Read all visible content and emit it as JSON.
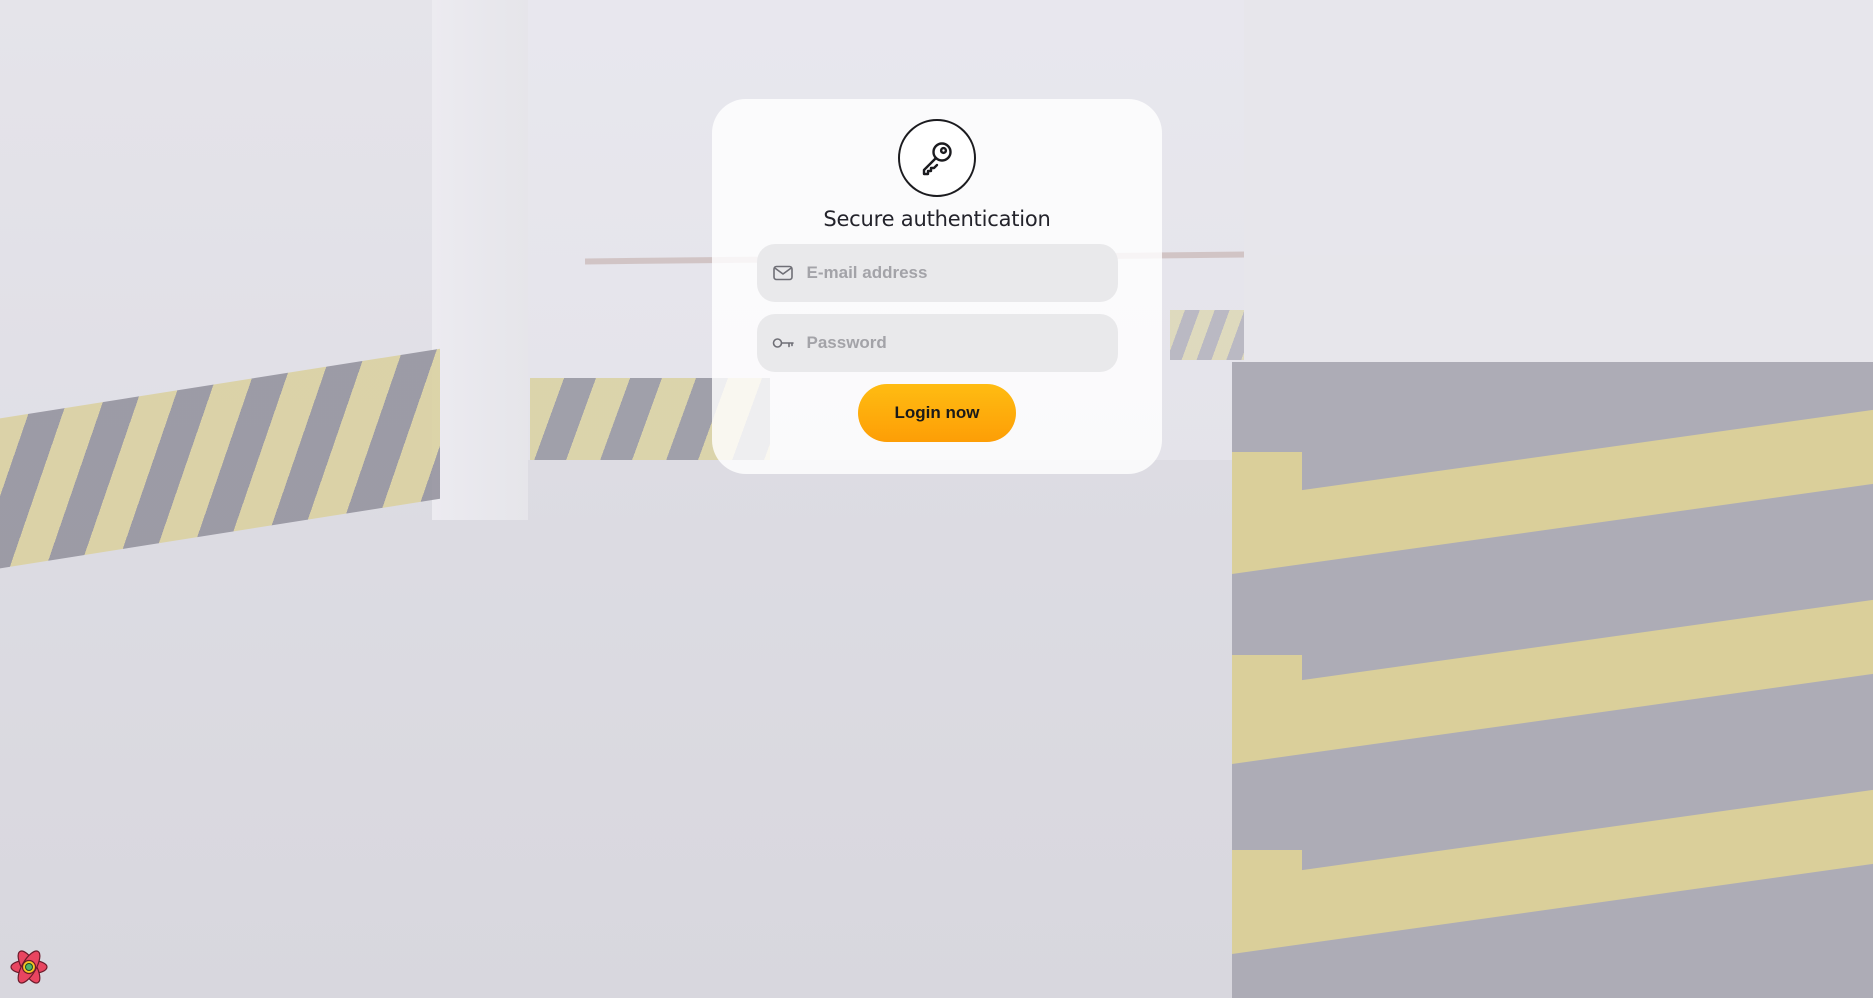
{
  "login": {
    "title": "Secure authentication",
    "email_placeholder": "E-mail address",
    "password_placeholder": "Password",
    "submit_label": "Login now"
  },
  "icons": {
    "badge": "key-icon",
    "email": "envelope-icon",
    "password": "key-icon",
    "corner": "react-logo-icon"
  },
  "colors": {
    "button_gradient_start": "#ffbc12",
    "button_gradient_end": "#fd9e06",
    "field_background": "#e9e9eb",
    "title_text": "#23232b",
    "placeholder_text": "#a3a3a8"
  }
}
